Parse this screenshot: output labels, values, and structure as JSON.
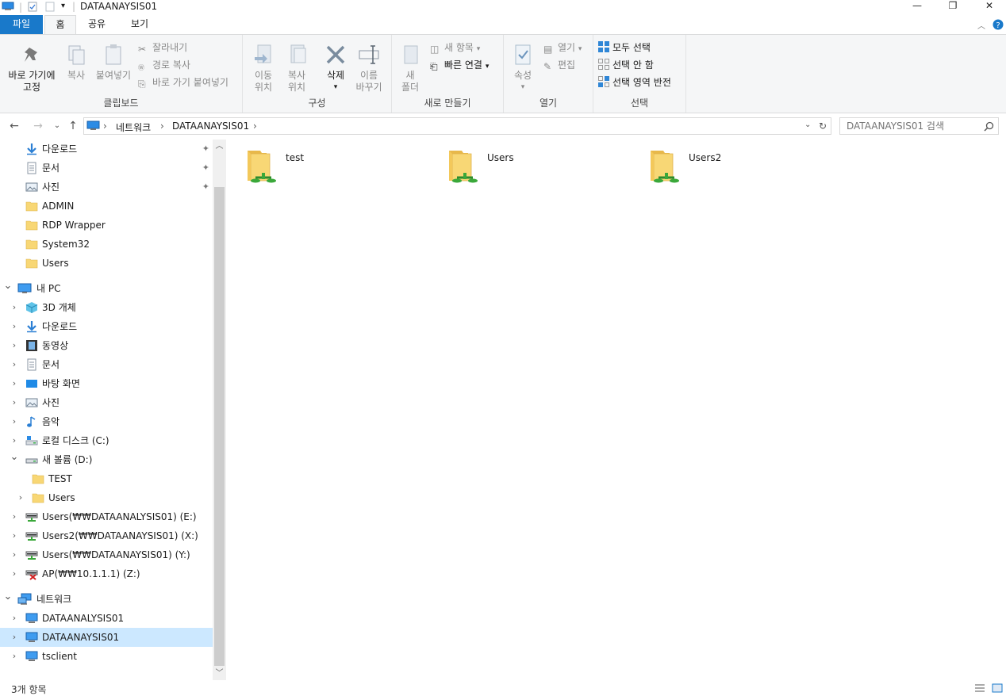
{
  "window": {
    "title": "DATAANAYSIS01",
    "minimize": "—",
    "maximize": "❐",
    "close": "✕"
  },
  "ribbon_tabs": [
    "파일",
    "홈",
    "공유",
    "보기"
  ],
  "ribbon": {
    "clipboard": {
      "label": "클립보드",
      "pin": "바로 가기에\n고정",
      "copy": "복사",
      "paste": "붙여넣기",
      "cut": "잘라내기",
      "copy_path": "경로 복사",
      "paste_shortcut": "바로 가기 붙여넣기"
    },
    "organize": {
      "label": "구성",
      "move_to": "이동\n위치",
      "copy_to": "복사\n위치",
      "delete": "삭제",
      "rename": "이름\n바꾸기"
    },
    "new": {
      "label": "새로 만들기",
      "new_folder": "새\n폴더",
      "new_item": "새 항목",
      "easy_access": "빠른 연결"
    },
    "open": {
      "label": "열기",
      "properties": "속성",
      "open": "열기",
      "edit": "편집"
    },
    "select": {
      "label": "선택",
      "select_all": "모두 선택",
      "select_none": "선택 안 함",
      "invert": "선택 영역 반전"
    }
  },
  "address": {
    "crumbs": [
      "네트워크",
      "DATAANAYSIS01"
    ],
    "search_placeholder": "DATAANAYSIS01 검색"
  },
  "nav": {
    "quick": [
      {
        "label": "다운로드",
        "icon": "download-icon",
        "pinned": true
      },
      {
        "label": "문서",
        "icon": "document-icon",
        "pinned": true
      },
      {
        "label": "사진",
        "icon": "pictures-icon",
        "pinned": true
      },
      {
        "label": "ADMIN",
        "icon": "folder-icon"
      },
      {
        "label": "RDP Wrapper",
        "icon": "folder-icon"
      },
      {
        "label": "System32",
        "icon": "folder-icon"
      },
      {
        "label": "Users",
        "icon": "folder-icon"
      }
    ],
    "this_pc": "내 PC",
    "pc_items": [
      {
        "label": "3D 개체",
        "icon": "3d-objects-icon"
      },
      {
        "label": "다운로드",
        "icon": "download-icon"
      },
      {
        "label": "동영상",
        "icon": "video-icon"
      },
      {
        "label": "문서",
        "icon": "document-icon"
      },
      {
        "label": "바탕 화면",
        "icon": "desktop-icon"
      },
      {
        "label": "사진",
        "icon": "pictures-icon"
      },
      {
        "label": "음악",
        "icon": "music-icon"
      },
      {
        "label": "로컬 디스크 (C:)",
        "icon": "local-disk-icon"
      }
    ],
    "volume_d": "새 볼륨 (D:)",
    "volume_d_children": [
      "TEST",
      "Users"
    ],
    "network_drives": [
      {
        "label": "Users(₩₩DATAANALYSIS01) (E:)",
        "disconnected": false
      },
      {
        "label": "Users2(₩₩DATAANAYSIS01) (X:)",
        "disconnected": false
      },
      {
        "label": "Users(₩₩DATAANAYSIS01) (Y:)",
        "disconnected": false
      },
      {
        "label": "AP(₩₩10.1.1.1) (Z:)",
        "disconnected": true
      }
    ],
    "network": "네트워크",
    "network_items": [
      {
        "label": "DATAANALYSIS01",
        "selected": false
      },
      {
        "label": "DATAANAYSIS01",
        "selected": true
      },
      {
        "label": "tsclient",
        "selected": false
      }
    ]
  },
  "content": {
    "items": [
      "test",
      "Users",
      "Users2"
    ]
  },
  "status": {
    "count": "3개 항목"
  },
  "colors": {
    "accent": "#1979ca",
    "selection": "#cce8ff",
    "folder": "#f8d775",
    "share_green": "#3aa83a"
  }
}
